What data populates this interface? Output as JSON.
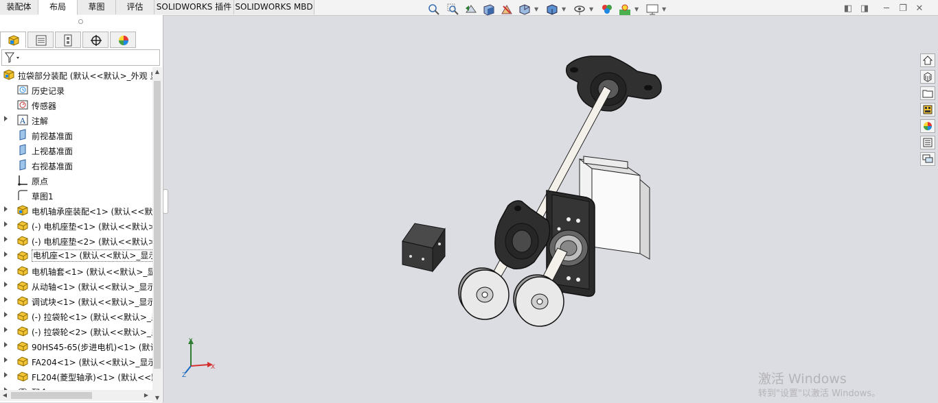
{
  "tabs": [
    {
      "label": "装配体",
      "active": false
    },
    {
      "label": "布局",
      "active": true
    },
    {
      "label": "草图",
      "active": false
    },
    {
      "label": "评估",
      "active": false
    },
    {
      "label": "SOLIDWORKS 插件",
      "active": false
    },
    {
      "label": "SOLIDWORKS MBD",
      "active": false
    }
  ],
  "heads_up_toolbar": [
    "zoom-to-fit-icon",
    "zoom-to-area-icon",
    "previous-view-icon",
    "section-view-icon",
    "dynamic-annotation-icon",
    "view-orientation-icon",
    "display-style-icon",
    "hide-show-items-icon",
    "edit-appearance-icon",
    "apply-scene-icon",
    "view-settings-icon"
  ],
  "feature_manager": {
    "panel_tabs": [
      "featuremanager-tree-icon",
      "propertymanager-icon",
      "configurationmanager-icon",
      "dimxpertmanager-icon",
      "displaymanager-icon"
    ],
    "more_arrow": "›",
    "root": {
      "label": "拉袋部分装配  (默认<<默认>_外观 显示",
      "icon": "assembly-icon"
    },
    "nodes": [
      {
        "label": "历史记录",
        "icon": "history-icon",
        "expandable": false,
        "indent": 1
      },
      {
        "label": "传感器",
        "icon": "sensor-icon",
        "expandable": false,
        "indent": 1
      },
      {
        "label": "注解",
        "icon": "annotation-icon",
        "expandable": true,
        "indent": 1
      },
      {
        "label": "前视基准面",
        "icon": "plane-icon",
        "expandable": false,
        "indent": 1
      },
      {
        "label": "上视基准面",
        "icon": "plane-icon",
        "expandable": false,
        "indent": 1
      },
      {
        "label": "右视基准面",
        "icon": "plane-icon",
        "expandable": false,
        "indent": 1
      },
      {
        "label": "原点",
        "icon": "origin-icon",
        "expandable": false,
        "indent": 1
      },
      {
        "label": "草图1",
        "icon": "sketch-icon",
        "expandable": false,
        "indent": 1
      },
      {
        "label": "电机轴承座装配<1> (默认<<默认",
        "icon": "subassembly-icon",
        "expandable": true,
        "indent": 1
      },
      {
        "label": "(-) 电机座垫<1> (默认<<默认>",
        "icon": "part-icon",
        "expandable": true,
        "indent": 1
      },
      {
        "label": "(-) 电机座垫<2> (默认<<默认>",
        "icon": "part-icon",
        "expandable": true,
        "indent": 1
      },
      {
        "label": "电机座<1> (默认<<默认>_显示",
        "icon": "part-icon",
        "expandable": true,
        "indent": 1,
        "boxed": true
      },
      {
        "label": "电机轴套<1> (默认<<默认>_显",
        "icon": "part-icon",
        "expandable": true,
        "indent": 1
      },
      {
        "label": "从动轴<1> (默认<<默认>_显示",
        "icon": "part-icon",
        "expandable": true,
        "indent": 1
      },
      {
        "label": "调试块<1> (默认<<默认>_显示",
        "icon": "part-icon",
        "expandable": true,
        "indent": 1
      },
      {
        "label": "(-) 拉袋轮<1> (默认<<默认>_显",
        "icon": "part-icon",
        "expandable": true,
        "indent": 1
      },
      {
        "label": "(-) 拉袋轮<2> (默认<<默认>_显",
        "icon": "part-icon",
        "expandable": true,
        "indent": 1
      },
      {
        "label": "90HS45-65(步进电机)<1> (默认",
        "icon": "part-icon",
        "expandable": true,
        "indent": 1
      },
      {
        "label": "FA204<1> (默认<<默认>_显示",
        "icon": "part-icon",
        "expandable": true,
        "indent": 1
      },
      {
        "label": "FL204(菱型轴承)<1> (默认<<默",
        "icon": "part-icon",
        "expandable": true,
        "indent": 1
      },
      {
        "label": "配合",
        "icon": "mates-icon",
        "expandable": true,
        "indent": 1
      }
    ]
  },
  "task_pane": [
    "solidworks-resources-icon",
    "design-library-icon",
    "file-explorer-icon",
    "view-palette-icon",
    "appearances-icon",
    "custom-properties-icon",
    "forum-icon"
  ],
  "triad": {
    "x": "X",
    "y": "Y",
    "z": "Z"
  },
  "watermark": {
    "title": "激活 Windows",
    "subtitle": "转到\"设置\"以激活 Windows。"
  },
  "colors": {
    "viewport_bg": "#dcdde2",
    "accent": "#1a66c9"
  }
}
